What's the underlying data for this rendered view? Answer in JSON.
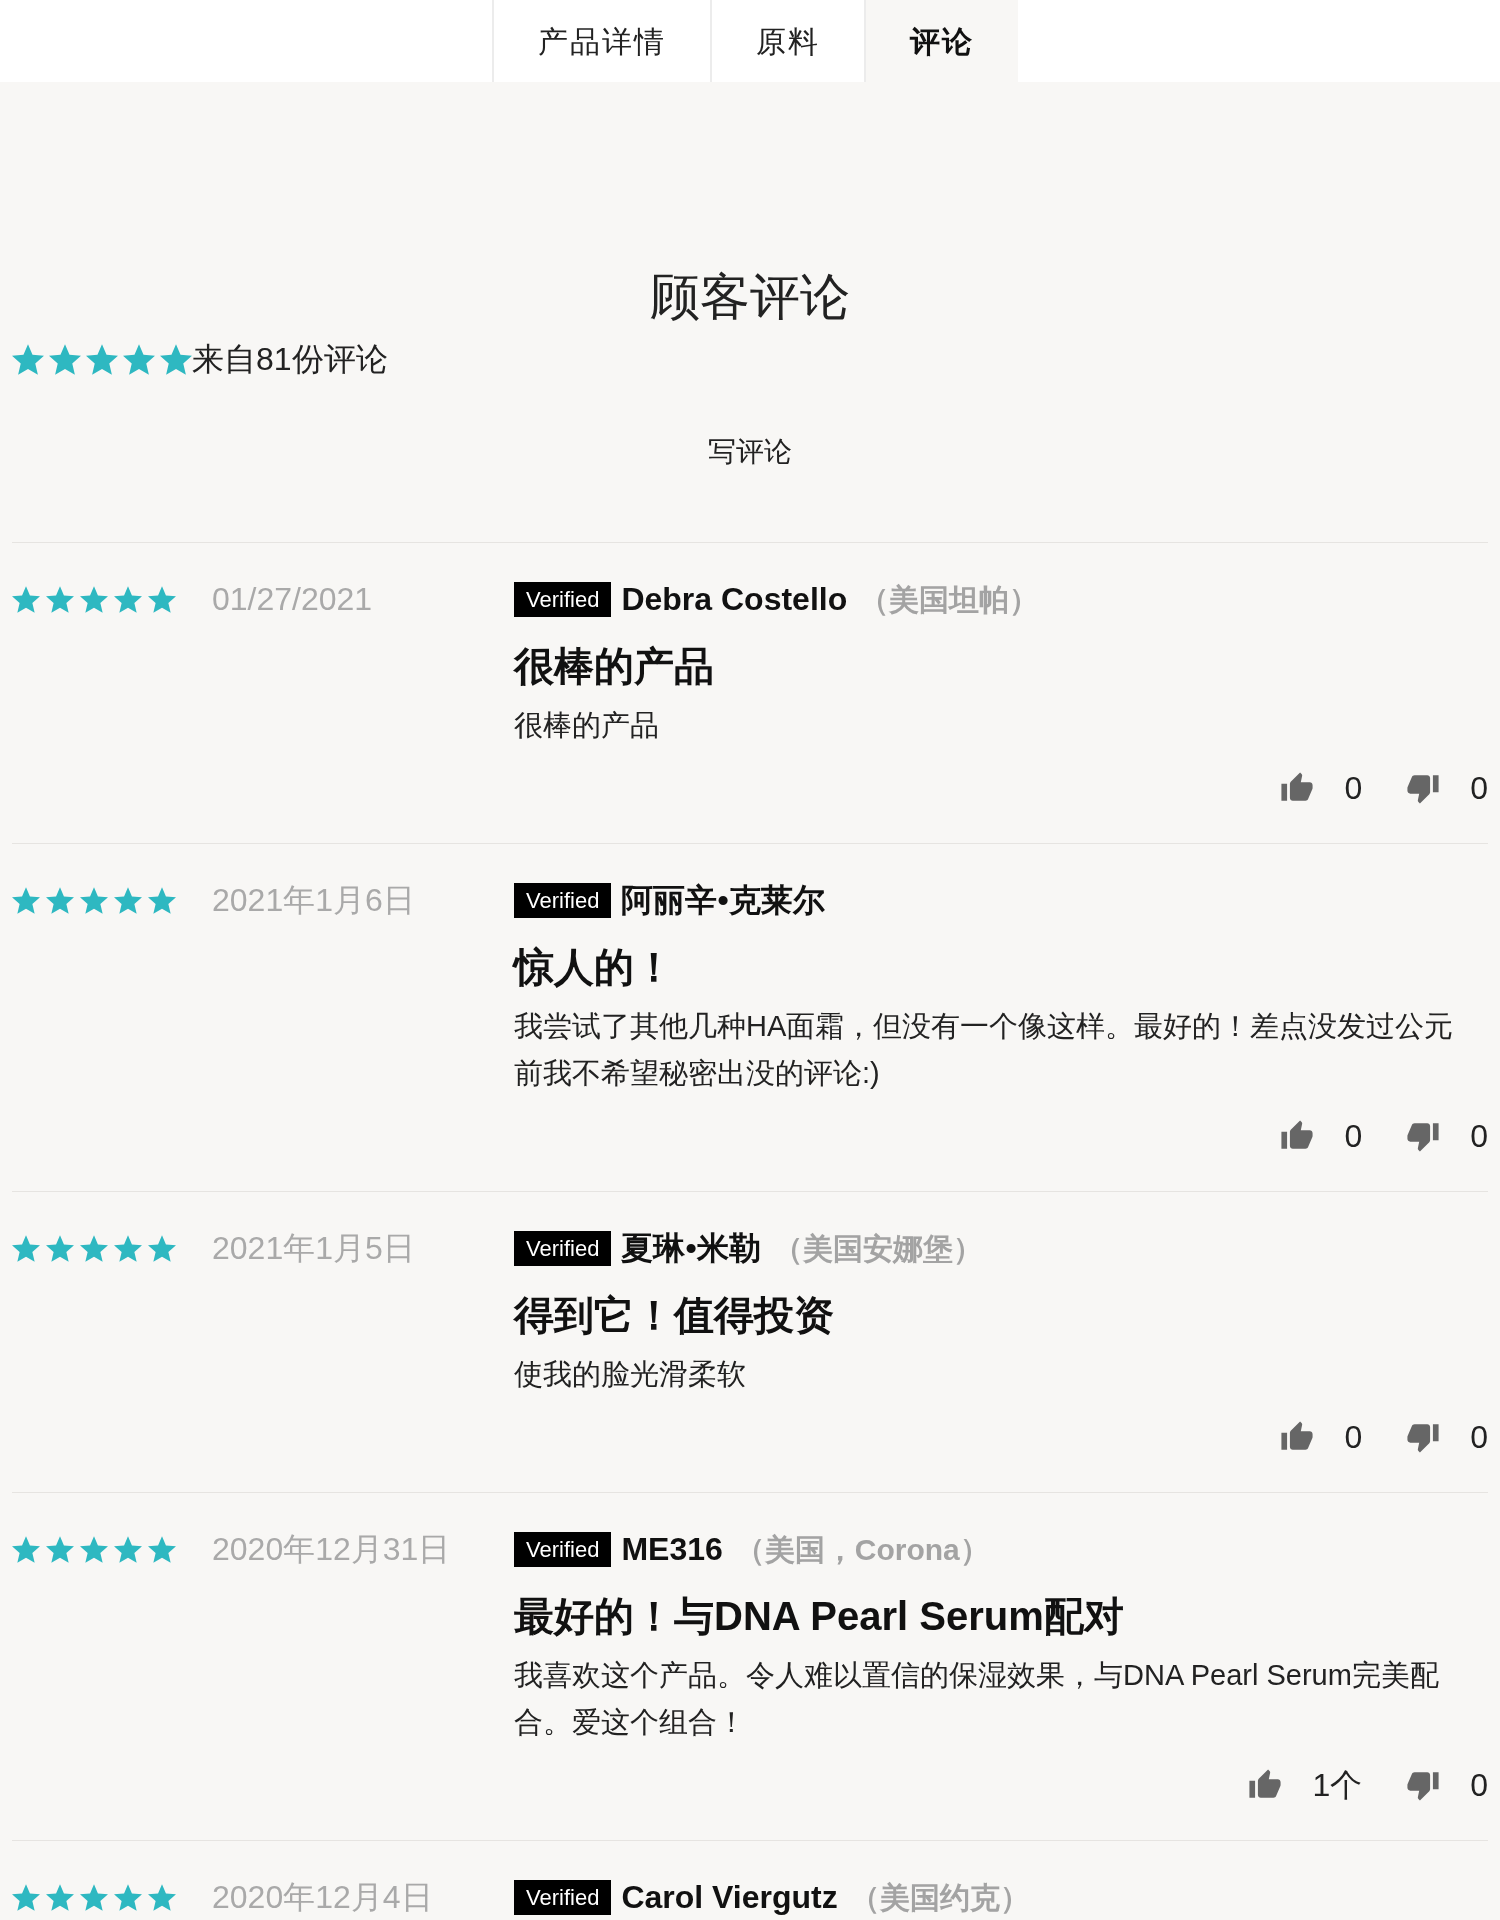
{
  "tabs": [
    {
      "label": "产品详情",
      "selected": false
    },
    {
      "label": "原料",
      "selected": false
    },
    {
      "label": "评论",
      "selected": true
    }
  ],
  "summary": {
    "title": "顾客评论",
    "stars": 5,
    "count_text": "来自81份评论",
    "write_review": "写评论"
  },
  "reviews": [
    {
      "stars": 5,
      "date": "01/27/2021",
      "badge": "Verified",
      "author": "Debra Costello",
      "location": "（美国坦帕）",
      "title": "很棒的产品",
      "body": "很棒的产品",
      "helpful": "0",
      "unhelpful": "0"
    },
    {
      "stars": 5,
      "date": "2021年1月6日",
      "badge": "Verified",
      "author": "阿丽辛•克莱尔",
      "title": "惊人的！",
      "body": "我尝试了其他几种HA面霜，但没有一个像这样。最好的！差点没发过公元前我不希望秘密出没的评论:)",
      "helpful": "0",
      "unhelpful": "0"
    },
    {
      "stars": 5,
      "date": "2021年1月5日",
      "badge": "Verified",
      "author": "夏琳•米勒",
      "location": "（美国安娜堡）",
      "title": "得到它！值得投资",
      "body": "使我的脸光滑柔软",
      "helpful": "0",
      "unhelpful": "0"
    },
    {
      "stars": 5,
      "date": "2020年12月31日",
      "badge": "Verified",
      "author": "ME316",
      "location": "（美国，Corona）",
      "title": "最好的！与DNA Pearl Serum配对",
      "body": "我喜欢这个产品。令人难以置信的保湿效果，与DNA Pearl Serum完美配合。爱这个组合！",
      "helpful": "1个",
      "unhelpful": "0"
    },
    {
      "stars": 5,
      "date": "2020年12月4日",
      "badge": "Verified",
      "author": "Carol Viergutz",
      "location": "（美国约克）"
    }
  ]
}
